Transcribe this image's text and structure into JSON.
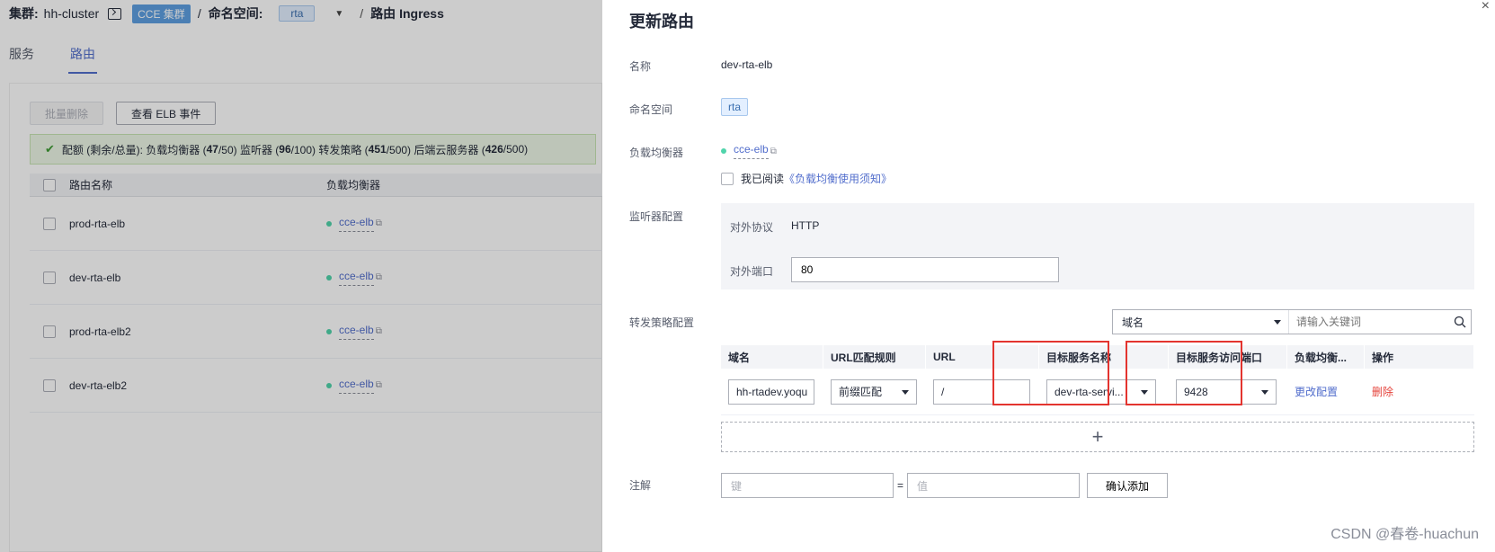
{
  "breadcrumb": {
    "cluster_label": "集群:",
    "cluster_name": "hh-cluster",
    "cluster_badge": "CCE 集群",
    "sep1": "/",
    "namespace_label": "命名空间:",
    "namespace_value": "rta",
    "sep2": "/",
    "page": "路由 Ingress"
  },
  "tabs": [
    {
      "label": "服务"
    },
    {
      "label": "路由"
    }
  ],
  "toolbar": {
    "batch_delete": "批量删除",
    "view_elb_events": "查看 ELB 事件"
  },
  "quota": {
    "prefix": "配额 (剩余/总量): 负载均衡器 (",
    "lb_used": "47",
    "lb_total": "/50)  监听器 (",
    "listener_used": "96",
    "listener_total": "/100)  转发策略 (",
    "policy_used": "451",
    "policy_total": "/500)  后端云服务器 (",
    "server_used": "426",
    "server_total": "/500)"
  },
  "ingress_table": {
    "headers": [
      "路由名称",
      "负载均衡器"
    ],
    "rows": [
      {
        "name": "prod-rta-elb",
        "lb": "cce-elb"
      },
      {
        "name": "dev-rta-elb",
        "lb": "cce-elb"
      },
      {
        "name": "prod-rta-elb2",
        "lb": "cce-elb"
      },
      {
        "name": "dev-rta-elb2",
        "lb": "cce-elb"
      }
    ]
  },
  "drawer": {
    "title": "更新路由",
    "close": "×",
    "name_label": "名称",
    "name_value": "dev-rta-elb",
    "namespace_label": "命名空间",
    "namespace_value": "rta",
    "lb_label": "负载均衡器",
    "lb_value": "cce-elb",
    "read_prefix": "我已阅读",
    "read_link": "《负载均衡使用须知》",
    "listener_label": "监听器配置",
    "protocol_label": "对外协议",
    "protocol_value": "HTTP",
    "port_label": "对外端口",
    "port_value": "80",
    "policy_label": "转发策略配置",
    "search_select": "域名",
    "search_placeholder": "请输入关键词",
    "rule_headers": [
      "域名",
      "URL匹配规则",
      "URL",
      "目标服务名称",
      "目标服务访问端口",
      "负载均衡...",
      "操作"
    ],
    "rule": {
      "domain": "hh-rtadev.yoqu",
      "match": "前缀匹配",
      "url": "/",
      "service": "dev-rta-servi...",
      "port": "9428",
      "change_config": "更改配置",
      "delete": "删除"
    },
    "add_symbol": "+",
    "annotation_label": "注解",
    "key_placeholder": "键",
    "eq": "=",
    "value_placeholder": "值",
    "confirm_add": "确认添加"
  },
  "watermark": "CSDN @春卷-huachun",
  "colors": {
    "primary": "#526ecc",
    "danger": "#e5433b",
    "highlight_box": "#e3342f",
    "success": "#3f9c35"
  }
}
